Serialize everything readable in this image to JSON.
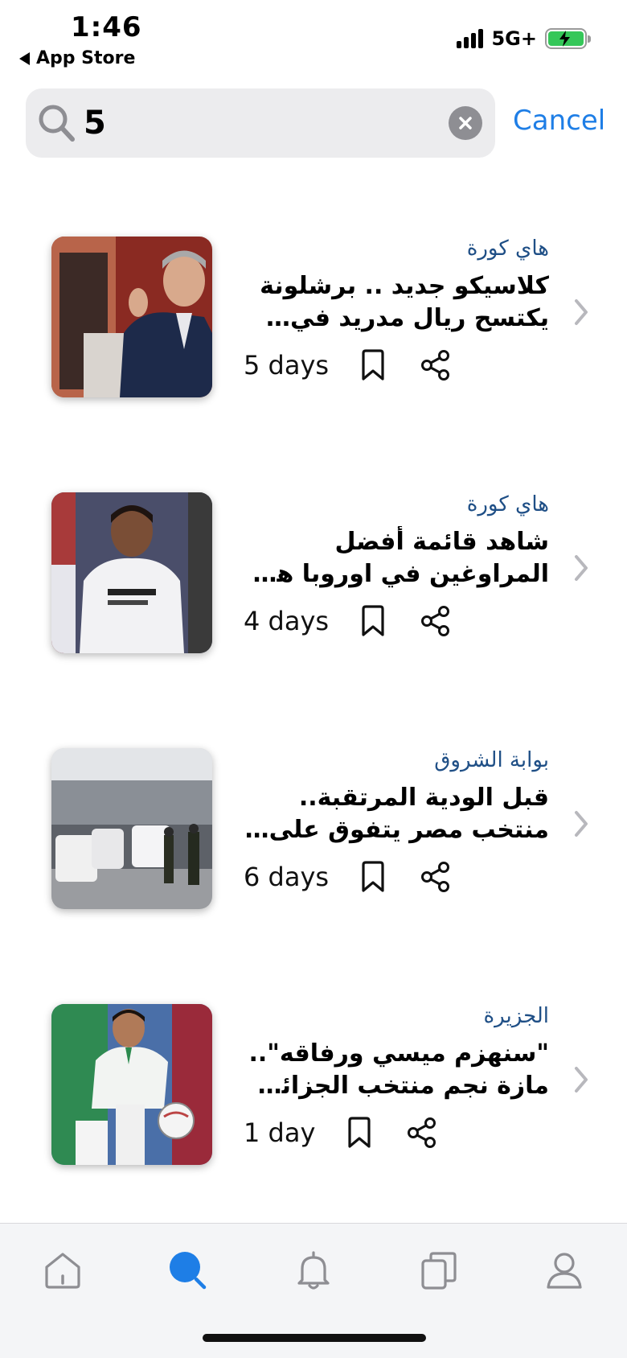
{
  "status_bar": {
    "time": "1:46",
    "back_app": "App Store",
    "network": "5G+"
  },
  "search": {
    "query": "5",
    "cancel_label": "Cancel"
  },
  "results": [
    {
      "source": "هاي كورة",
      "title": "كلاسيكو جديد .. برشلونة يكتسح ريال مدريد في سباق التعاقد مع نجم جديد",
      "age": "5 days"
    },
    {
      "source": "هاي كورة",
      "title": "شاهد قائمة أفضل المراوغين في اوروبا هذا الموسم",
      "age": "4 days"
    },
    {
      "source": "بوابة الشروق",
      "title": "قبل الودية المرتقبة.. منتخب مصر يتفوق على البرازيل",
      "age": "6 days"
    },
    {
      "source": "الجزيرة",
      "title": "\"سنهزم ميسي ورفاقه\".. مازة نجم منتخب الجزائر يتحدى المنتخب الأرجنتيني",
      "age": "1 day"
    }
  ],
  "tabs": [
    "home-icon",
    "search-icon",
    "bell-icon",
    "stacked-cards-icon",
    "person-icon"
  ],
  "colors": {
    "accent": "#1e7ee6",
    "source_text": "#1f4f86",
    "active_tab": "#1e7ee6",
    "inactive_tab": "#8e8e93",
    "battery": "#35c759"
  }
}
